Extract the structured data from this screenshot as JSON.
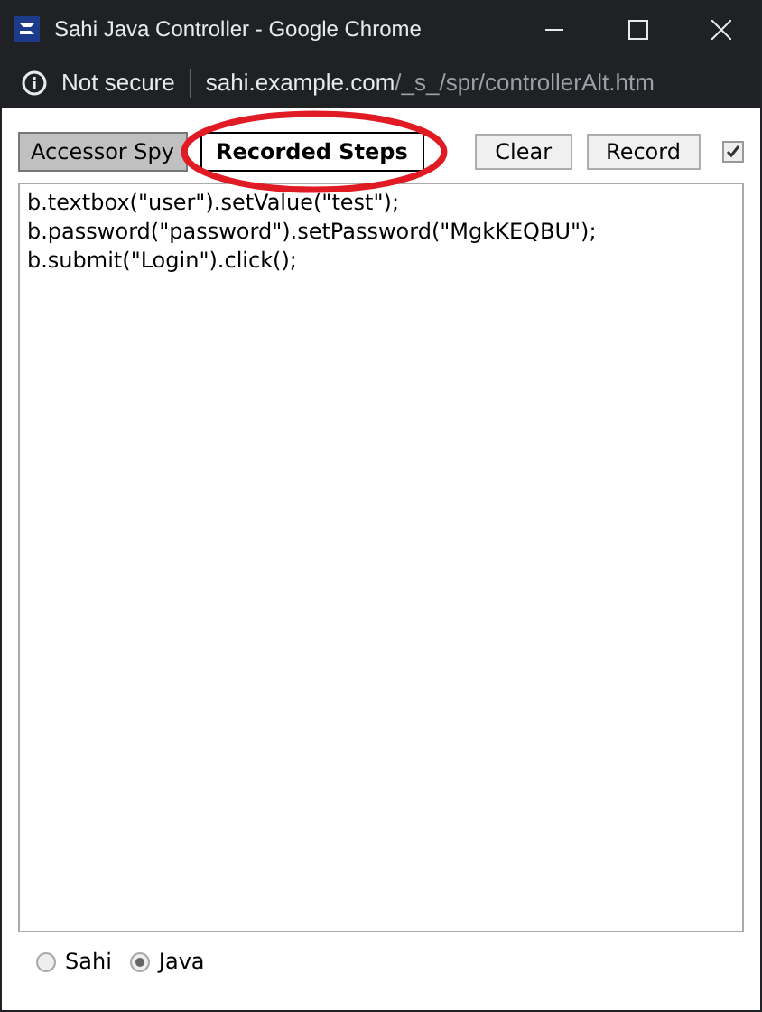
{
  "window": {
    "title": "Sahi Java Controller - Google Chrome"
  },
  "address_bar": {
    "security": "Not secure",
    "host": "sahi.example.com",
    "path": "/_s_/spr/controllerAlt.htm"
  },
  "tabs": [
    {
      "label": "Accessor Spy",
      "selected": false
    },
    {
      "label": "Recorded Steps",
      "selected": true,
      "circled": true
    }
  ],
  "buttons": [
    "Clear",
    "Record"
  ],
  "record_checkbox": {
    "checked": true
  },
  "steps": [
    "b.textbox(\"user\").setValue(\"test\");",
    "b.password(\"password\").setPassword(\"MgkKEQBU\");",
    "b.submit(\"Login\").click();"
  ],
  "languages": [
    {
      "label": "Sahi",
      "selected": false
    },
    {
      "label": "Java",
      "selected": true
    }
  ]
}
